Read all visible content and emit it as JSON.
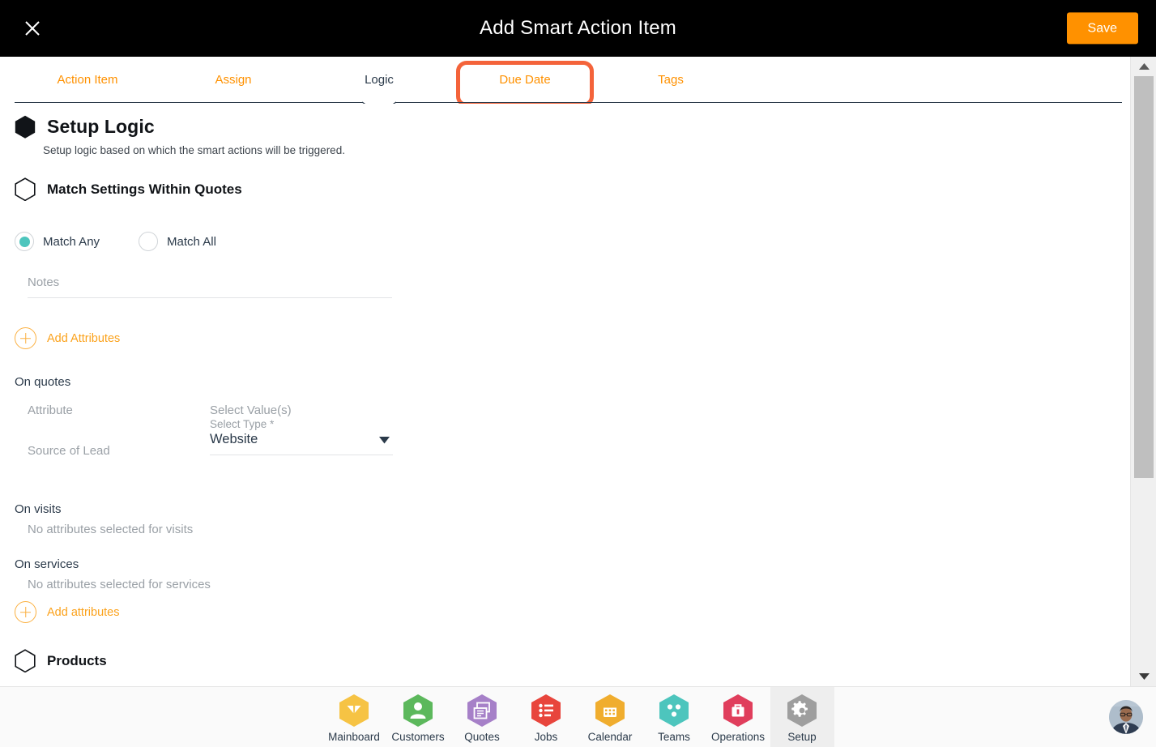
{
  "titlebar": {
    "close_icon": "close-icon",
    "title": "Add Smart Action Item",
    "save_label": "Save"
  },
  "tabs": {
    "items": [
      {
        "label": "Action Item",
        "state": "inactive"
      },
      {
        "label": "Assign",
        "state": "inactive"
      },
      {
        "label": "Logic",
        "state": "active"
      },
      {
        "label": "Due Date",
        "state": "highlighted"
      },
      {
        "label": "Tags",
        "state": "inactive"
      }
    ]
  },
  "logic": {
    "heading": "Setup Logic",
    "heading_icon": "hexagon-filled-icon",
    "description": "Setup logic based on which the smart actions will be triggered.",
    "match_section": {
      "heading": "Match Settings Within Quotes",
      "heading_icon": "hexagon-outline-icon",
      "radios": [
        {
          "label": "Match Any",
          "selected": true
        },
        {
          "label": "Match All",
          "selected": false
        }
      ],
      "notes": {
        "value": "",
        "placeholder": "Notes"
      },
      "add_attributes": {
        "label": "Add Attributes",
        "icon": "plus-circle-icon"
      }
    },
    "on_quotes": {
      "group_label": "On quotes",
      "col_attribute": "Attribute",
      "col_values": "Select Value(s)",
      "rows": [
        {
          "attribute": "Source of Lead",
          "select_label": "Select Type *",
          "select_value": "Website",
          "caret_icon": "chevron-down-icon"
        }
      ]
    },
    "on_visits": {
      "group_label": "On visits",
      "empty_text": "No attributes selected for visits"
    },
    "on_services": {
      "group_label": "On services",
      "empty_text": "No attributes selected for services",
      "add_attributes": {
        "label": "Add attributes",
        "icon": "plus-circle-icon"
      }
    },
    "products": {
      "heading": "Products",
      "heading_icon": "hexagon-outline-icon"
    }
  },
  "scrollbar": {
    "up_icon": "scroll-up-arrow-icon",
    "down_icon": "scroll-down-arrow-icon",
    "thumb": "scrollbar-thumb"
  },
  "bottom_nav": {
    "items": [
      {
        "label": "Mainboard",
        "icon": "mainboard-icon",
        "color": "#F6C344",
        "active": false
      },
      {
        "label": "Customers",
        "icon": "customers-icon",
        "color": "#5CB85C",
        "active": false
      },
      {
        "label": "Quotes",
        "icon": "quotes-icon",
        "color": "#A680C8",
        "active": false
      },
      {
        "label": "Jobs",
        "icon": "jobs-icon",
        "color": "#E8453C",
        "active": false
      },
      {
        "label": "Calendar",
        "icon": "calendar-icon",
        "color": "#F0AD2E",
        "active": false
      },
      {
        "label": "Teams",
        "icon": "teams-icon",
        "color": "#4DC5BD",
        "active": false
      },
      {
        "label": "Operations",
        "icon": "operations-icon",
        "color": "#E03E5C",
        "active": false
      },
      {
        "label": "Setup",
        "icon": "setup-gear-icon",
        "color": "#9E9E9E",
        "active": true
      }
    ],
    "avatar": "user-avatar"
  },
  "colors": {
    "accent_orange": "#FF9100",
    "highlight_orange": "#F4633A",
    "teal": "#4DC5BD",
    "dark_navy": "#2b3a4a"
  }
}
